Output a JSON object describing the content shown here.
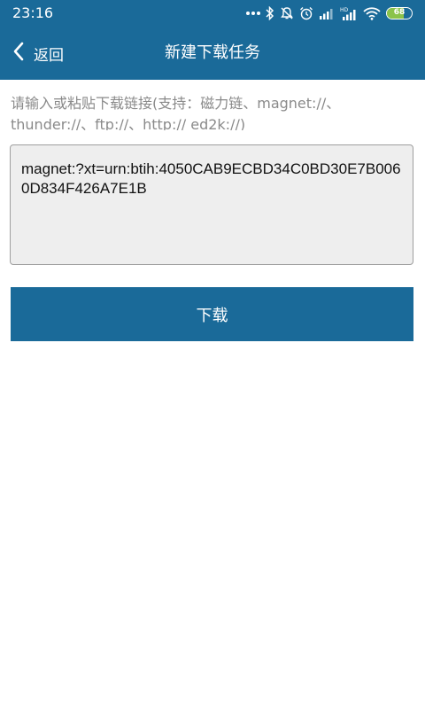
{
  "status_bar": {
    "time": "23:16",
    "battery_percent": 68,
    "battery_label": "68",
    "icons": [
      "more-dots-icon",
      "bluetooth-icon",
      "notifications-off-icon",
      "alarm-icon",
      "signal-icon",
      "signal-hd-icon",
      "wifi-icon",
      "battery-icon"
    ]
  },
  "app_bar": {
    "back_label": "返回",
    "title": "新建下载任务"
  },
  "form": {
    "hint": "请输入或粘贴下载链接(支持：磁力链、magnet://、thunder://、ftp://、http:// ed2k://)",
    "link_value": "magnet:?xt=urn:btih:4050CAB9ECBD34C0BD30E7B0060D834F426A7E1B",
    "download_label": "下载"
  },
  "colors": {
    "primary": "#1a6a99",
    "input_background": "#eeeeee",
    "hint_text": "#8a8a8a",
    "battery_fill": "#8bc34a"
  }
}
